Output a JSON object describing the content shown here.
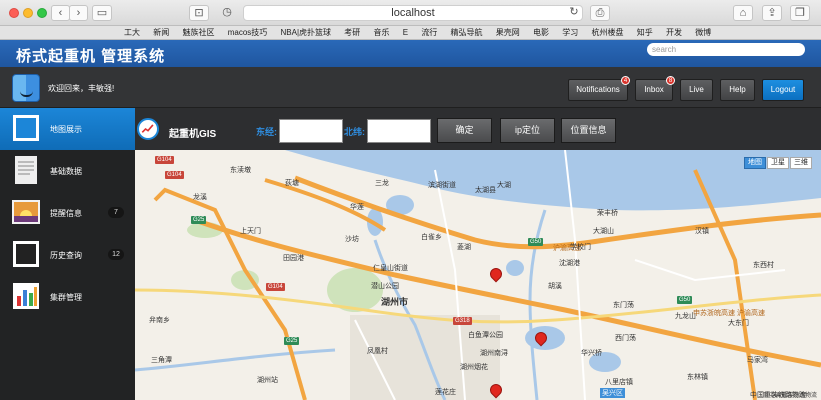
{
  "browser": {
    "address": "localhost",
    "bookmarks": [
      "工大",
      "新闻",
      "魅族社区",
      "macos技巧",
      "NBA|虎扑篮球",
      "考研",
      "音乐",
      "E",
      "流行",
      "精弘导航",
      "果壳网",
      "电影",
      "学习",
      "杭州楼盘",
      "知乎",
      "开发",
      "微博"
    ]
  },
  "app": {
    "title": "桥式起重机 管理系统",
    "search_placeholder": "search",
    "welcome": "欢迎回来，丰敏强!"
  },
  "header_buttons": {
    "notifications": "Notifications",
    "notifications_badge": "4",
    "inbox": "Inbox",
    "inbox_badge": "8",
    "live": "Live",
    "help": "Help",
    "logout": "Logout"
  },
  "sidebar": {
    "items": [
      {
        "label": "地图展示",
        "count": ""
      },
      {
        "label": "基础数据",
        "count": ""
      },
      {
        "label": "提醒信息",
        "count": "7"
      },
      {
        "label": "历史查询",
        "count": "12"
      },
      {
        "label": "集群管理",
        "count": ""
      }
    ]
  },
  "toolbar": {
    "title": "起重机GIS",
    "east_label": "东经:",
    "north_label": "北纬:",
    "confirm": "确定",
    "ip_locate": "ip定位",
    "position_info": "位置信息"
  },
  "map": {
    "types": [
      "地图",
      "卫星",
      "三维"
    ],
    "labels": [
      "东渎墩",
      "滨湖街道",
      "大湖",
      "龙溪",
      "荻塘",
      "三龙",
      "华莲",
      "上天门",
      "田园港",
      "沙坊",
      "白雀乡",
      "仁皇山街道",
      "湖州市",
      "潜山公园",
      "凤凰村",
      "菱湖",
      "白鱼潭公园",
      "湖州南浔",
      "湖州烟花",
      "华兴桥",
      "八里店镇",
      "吴兴区",
      "东林镇",
      "胡溪",
      "沈湖港",
      "大东门",
      "东门荡",
      "西门荡",
      "莲花庄",
      "马家湾",
      "中国重装铁路物流",
      "弁南乡",
      "三角潭",
      "湖州站",
      "汉镇",
      "沪渝高速",
      "申苏浙皖高速 沪渝高速",
      "九龙山",
      "荣丰桥",
      "大湖山",
      "太湖县",
      "学校门",
      "东西村"
    ],
    "road_shields": [
      "G104",
      "G104",
      "G25",
      "G50",
      "G318",
      "G104",
      "G25",
      "G50"
    ],
    "copyright": "© 中国重装铁路物流"
  }
}
